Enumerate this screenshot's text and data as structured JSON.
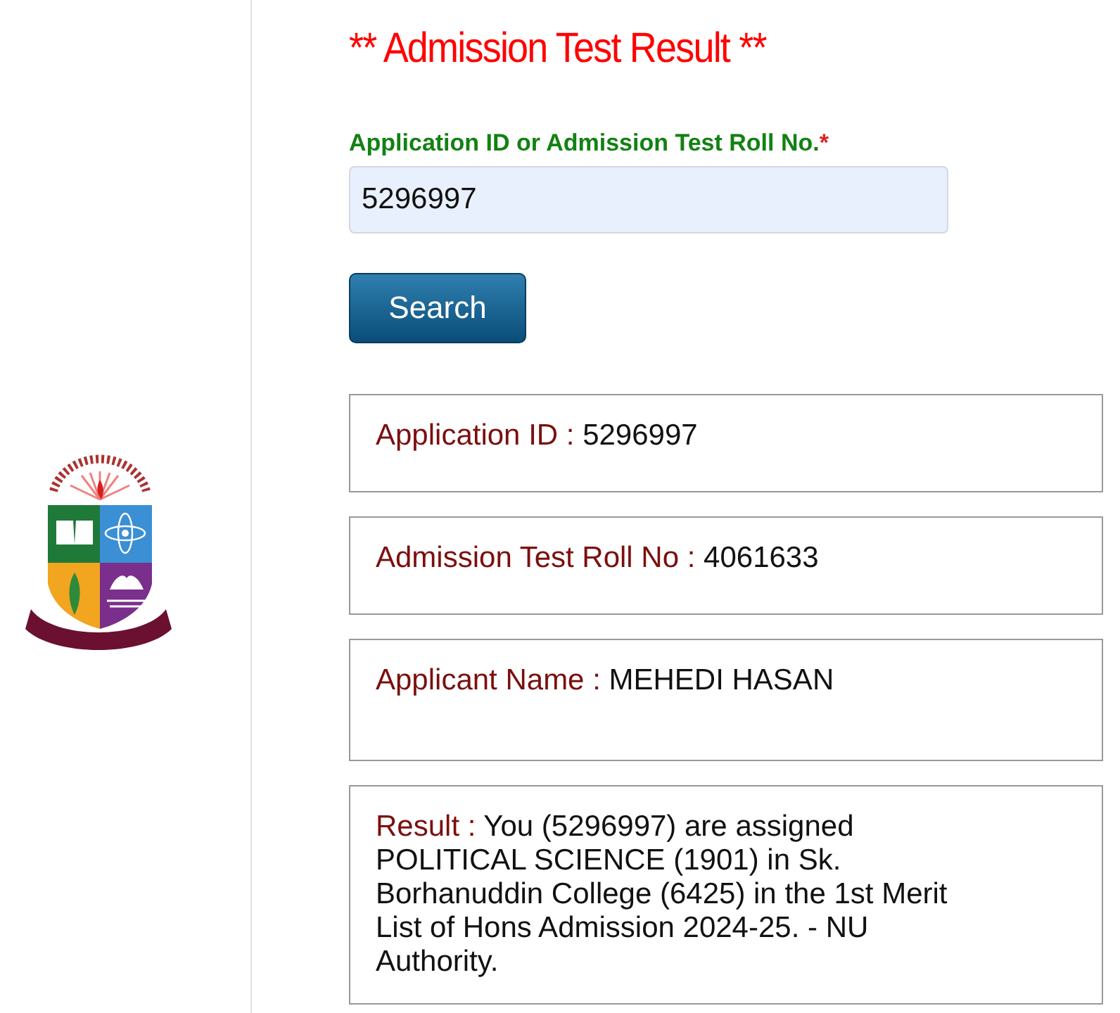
{
  "title": "** Admission Test Result **",
  "form": {
    "label": "Application ID or Admission Test Roll No.",
    "required_mark": "*",
    "value": "5296997",
    "button": "Search"
  },
  "results": [
    {
      "label": "Application ID :",
      "value": "5296997",
      "kind": "short"
    },
    {
      "label": "Admission Test Roll No :",
      "value": "4061633",
      "kind": "short"
    },
    {
      "label": "Applicant Name :",
      "value": "MEHEDI HASAN",
      "kind": "medium"
    },
    {
      "label": "Result :",
      "value": "You (5296997) are assigned\nPOLITICAL SCIENCE (1901) in Sk.\nBorhanuddin College (6425) in the 1st Merit\nList of Hons Admission 2024-25. - NU\nAuthority.",
      "kind": "long"
    }
  ]
}
